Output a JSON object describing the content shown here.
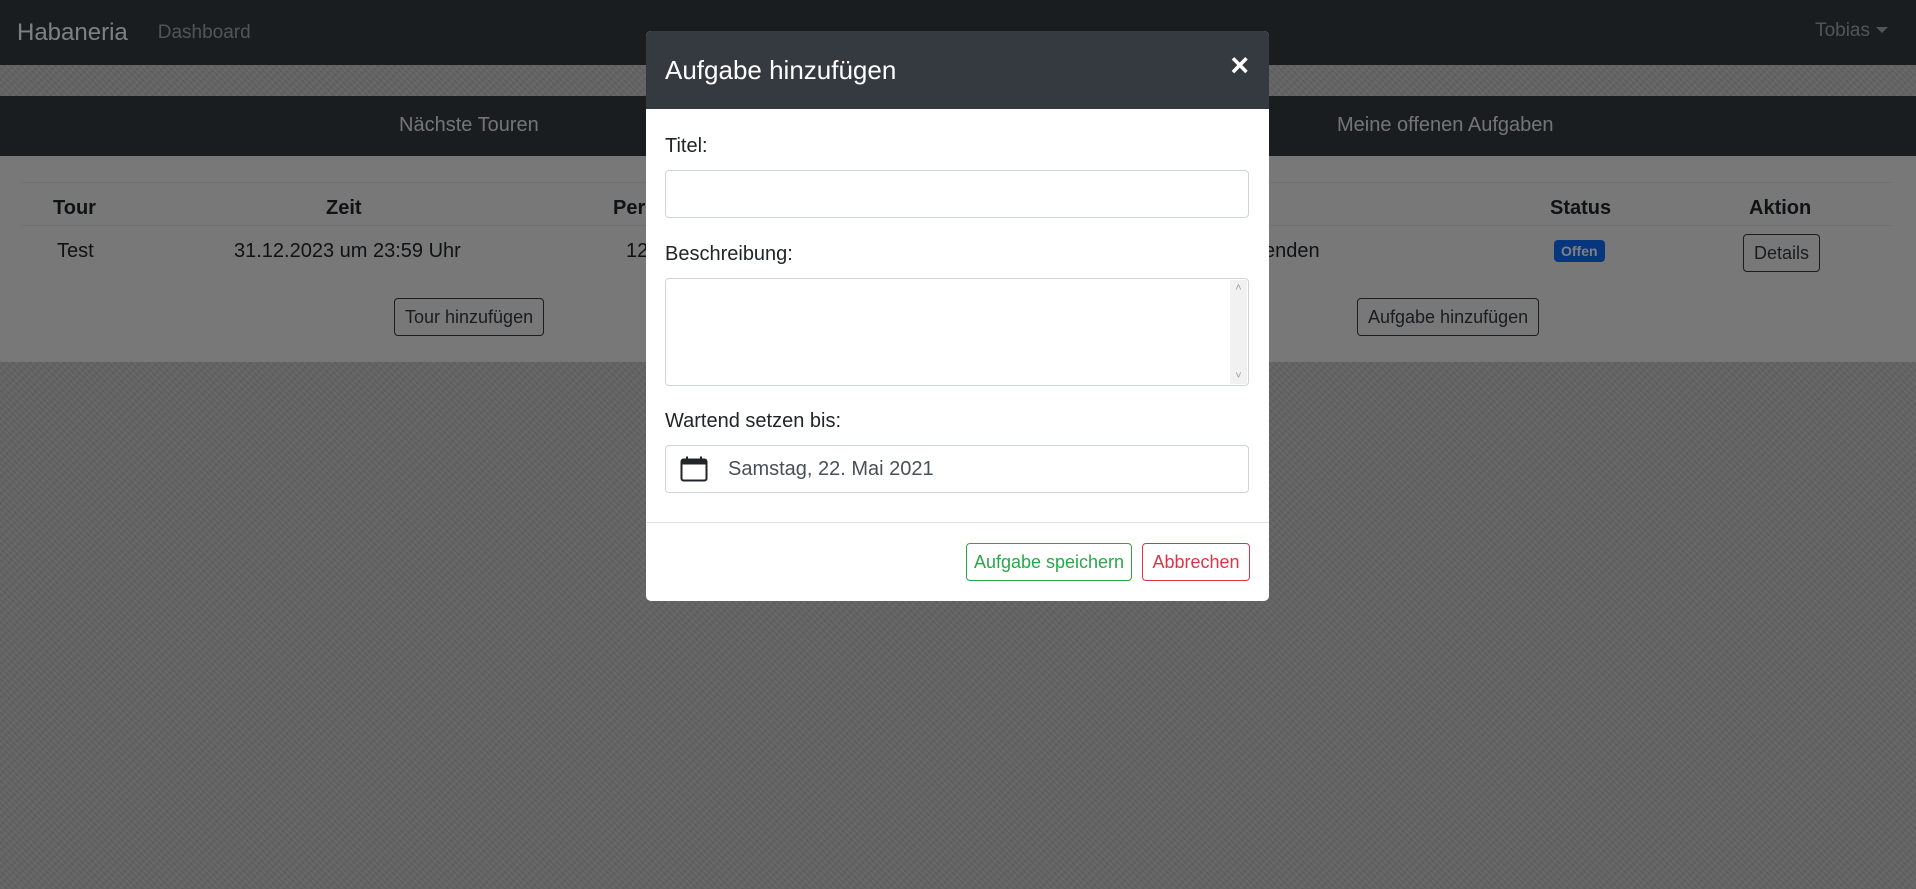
{
  "navbar": {
    "brand": "Habaneria",
    "dashboard_link": "Dashboard",
    "user": "Tobias"
  },
  "sections": {
    "tours_heading": "Nächste Touren",
    "tasks_heading": "Meine offenen Aufgaben"
  },
  "tours_table": {
    "headers": [
      "Tour",
      "Zeit",
      "Pers"
    ],
    "row": [
      "Test",
      "31.12.2023 um 23:59 Uhr",
      "12"
    ],
    "add_button": "Tour hinzufügen"
  },
  "tasks_table": {
    "headers": [
      "Status",
      "Aktion"
    ],
    "row_partial_text": "senden",
    "status_badge": "Offen",
    "details_button": "Details",
    "add_button": "Aufgabe hinzufügen"
  },
  "modal": {
    "title": "Aufgabe hinzufügen",
    "close_symbol": "×",
    "title_label": "Titel:",
    "title_value": "",
    "description_label": "Beschreibung:",
    "description_value": "",
    "waiting_label": "Wartend setzen bis:",
    "waiting_date": "Samstag, 22. Mai 2021",
    "save_button": "Aufgabe speichern",
    "cancel_button": "Abbrechen"
  },
  "colors": {
    "dark": "#343a40",
    "success": "#28a745",
    "danger": "#dc3545",
    "primary": "#0d6efd"
  }
}
